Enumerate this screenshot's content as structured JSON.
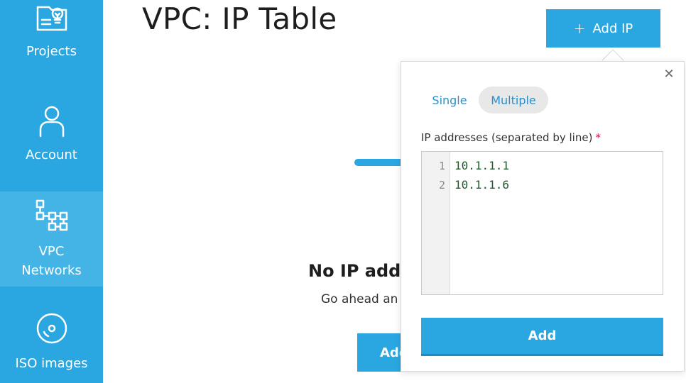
{
  "sidebar": {
    "items": [
      {
        "label": "Projects",
        "icon": "projects-icon"
      },
      {
        "label": "Account",
        "icon": "account-icon"
      },
      {
        "label": "VPC\nNetworks",
        "icon": "vpc-networks-icon",
        "active": true
      },
      {
        "label": "ISO images",
        "icon": "iso-images-icon"
      }
    ]
  },
  "header": {
    "title": "VPC: IP Table",
    "add_ip_label": "Add IP",
    "add_ip_icon": "plus-icon"
  },
  "empty_state": {
    "title": "No IP addr",
    "subtitle": "Go ahead an",
    "button_label": "Add"
  },
  "popover": {
    "close_icon": "close-icon",
    "tabs": [
      {
        "label": "Single",
        "active": false
      },
      {
        "label": "Multiple",
        "active": true
      }
    ],
    "field_label": "IP addresses (separated by line)",
    "required_mark": "*",
    "editor": {
      "line_numbers": [
        "1",
        "2"
      ],
      "lines": [
        "10.1.1.1",
        "10.1.1.6"
      ]
    },
    "submit_label": "Add"
  },
  "colors": {
    "brand": "#2aa7e0",
    "sidebar_active": "#44b4e6",
    "required": "#c2185b",
    "code_text": "#1d5a2d"
  }
}
